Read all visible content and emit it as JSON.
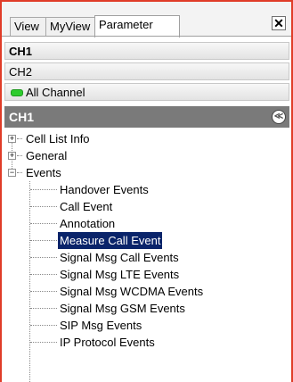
{
  "tabs": [
    {
      "label": "View"
    },
    {
      "label": "MyView"
    },
    {
      "label": "Parameter"
    }
  ],
  "close_symbol": "✕",
  "channels": {
    "ch1": "CH1",
    "ch2": "CH2",
    "all": "All Channel"
  },
  "header": {
    "title": "CH1",
    "collapse_symbol": "≪"
  },
  "tree": {
    "top_items": [
      {
        "label": "Cell List Info",
        "expanded": false
      },
      {
        "label": "General",
        "expanded": false
      },
      {
        "label": "Events",
        "expanded": true
      }
    ],
    "event_children": [
      {
        "label": "Handover Events"
      },
      {
        "label": "Call Event"
      },
      {
        "label": "Annotation"
      },
      {
        "label": "Measure Call Event",
        "selected": true
      },
      {
        "label": "Signal Msg Call Events"
      },
      {
        "label": "Signal Msg LTE Events"
      },
      {
        "label": "Signal Msg WCDMA Events"
      },
      {
        "label": "Signal Msg GSM Events"
      },
      {
        "label": "SIP Msg Events"
      },
      {
        "label": "IP Protocol Events"
      }
    ]
  },
  "colors": {
    "frame_border": "#e03c28",
    "selection": "#0a246a",
    "header_bg": "#7a7a7a",
    "led": "#2ecc2e"
  }
}
